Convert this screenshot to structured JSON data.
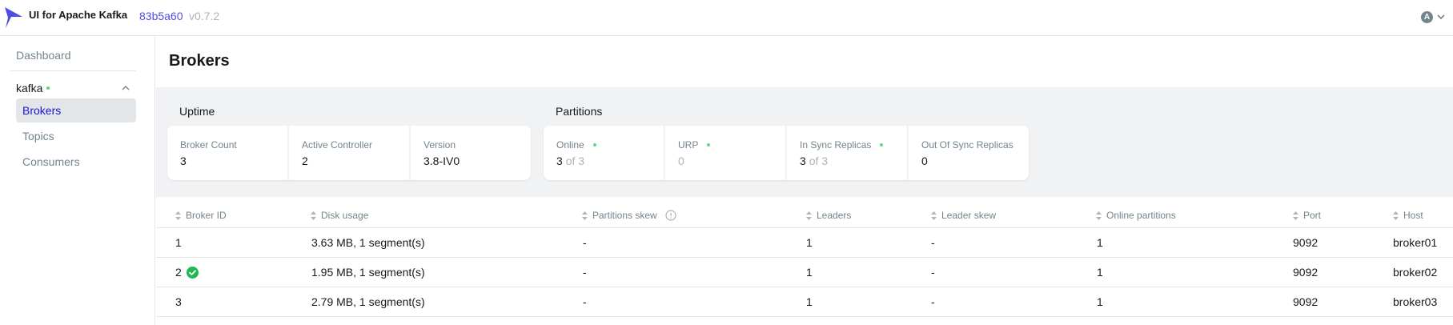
{
  "header": {
    "app_name": "UI for Apache Kafka",
    "commit": "83b5a60",
    "version": "v0.7.2",
    "user_initial": "A",
    "brand_color": "#4f4ee4"
  },
  "sidebar": {
    "dashboard": "Dashboard",
    "cluster_name": "kafka",
    "cluster_status": "online",
    "items": [
      {
        "label": "Brokers",
        "active": true
      },
      {
        "label": "Topics",
        "active": false
      },
      {
        "label": "Consumers",
        "active": false
      }
    ]
  },
  "page": {
    "title": "Brokers"
  },
  "uptime": {
    "title": "Uptime",
    "cards": [
      {
        "label": "Broker Count",
        "value": "3"
      },
      {
        "label": "Active Controller",
        "value": "2"
      },
      {
        "label": "Version",
        "value": "3.8-IV0"
      }
    ]
  },
  "partitions": {
    "title": "Partitions",
    "cards": [
      {
        "label": "Online",
        "value": "3",
        "suffix": "of 3",
        "status_dot": true
      },
      {
        "label": "URP",
        "value": "0",
        "status_dot": true
      },
      {
        "label": "In Sync Replicas",
        "value": "3",
        "suffix": "of 3",
        "status_dot": true
      },
      {
        "label": "Out Of Sync Replicas",
        "value": "0"
      }
    ]
  },
  "table": {
    "columns": [
      "Broker ID",
      "Disk usage",
      "Partitions skew",
      "Leaders",
      "Leader skew",
      "Online partitions",
      "Port",
      "Host"
    ],
    "rows": [
      {
        "broker_id": "1",
        "controller": false,
        "disk_usage": "3.63 MB, 1 segment(s)",
        "partitions_skew": "-",
        "leaders": "1",
        "leader_skew": "-",
        "online_partitions": "1",
        "port": "9092",
        "host": "broker01"
      },
      {
        "broker_id": "2",
        "controller": true,
        "disk_usage": "1.95 MB, 1 segment(s)",
        "partitions_skew": "-",
        "leaders": "1",
        "leader_skew": "-",
        "online_partitions": "1",
        "port": "9092",
        "host": "broker02"
      },
      {
        "broker_id": "3",
        "controller": false,
        "disk_usage": "2.79 MB, 1 segment(s)",
        "partitions_skew": "-",
        "leaders": "1",
        "leader_skew": "-",
        "online_partitions": "1",
        "port": "9092",
        "host": "broker03"
      }
    ]
  }
}
